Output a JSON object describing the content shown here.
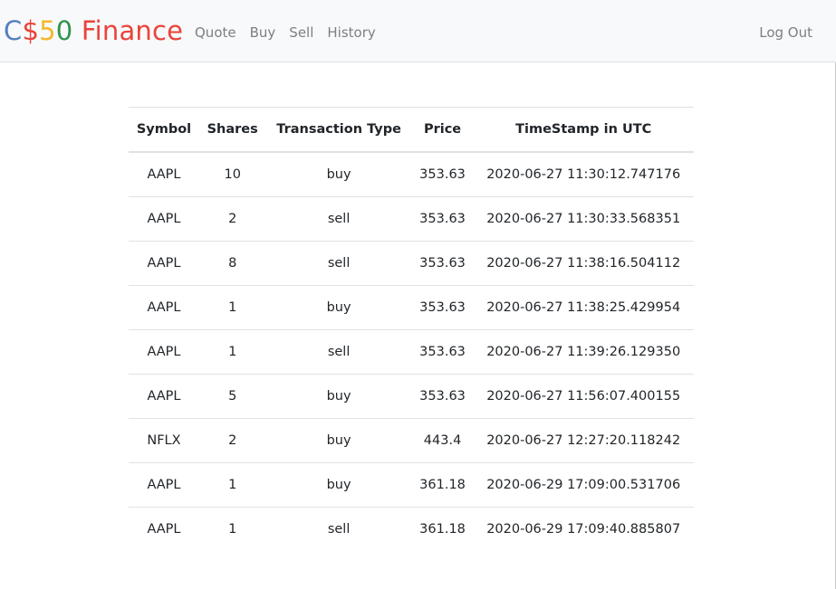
{
  "brand": {
    "c": "C",
    "dollar": "$",
    "five": "5",
    "zero": "0",
    "finance": " Finance"
  },
  "nav": {
    "quote": "Quote",
    "buy": "Buy",
    "sell": "Sell",
    "history": "History",
    "logout": "Log Out"
  },
  "colors": {
    "blue": "#537fbe",
    "red": "#ea433b",
    "yellow": "#f5b82e",
    "green": "#2e944b",
    "nav_bg": "#f8f9fa"
  },
  "table": {
    "headers": [
      "Symbol",
      "Shares",
      "Transaction Type",
      "Price",
      "TimeStamp in UTC"
    ],
    "rows": [
      [
        "AAPL",
        "10",
        "buy",
        "353.63",
        "2020-06-27 11:30:12.747176"
      ],
      [
        "AAPL",
        "2",
        "sell",
        "353.63",
        "2020-06-27 11:30:33.568351"
      ],
      [
        "AAPL",
        "8",
        "sell",
        "353.63",
        "2020-06-27 11:38:16.504112"
      ],
      [
        "AAPL",
        "1",
        "buy",
        "353.63",
        "2020-06-27 11:38:25.429954"
      ],
      [
        "AAPL",
        "1",
        "sell",
        "353.63",
        "2020-06-27 11:39:26.129350"
      ],
      [
        "AAPL",
        "5",
        "buy",
        "353.63",
        "2020-06-27 11:56:07.400155"
      ],
      [
        "NFLX",
        "2",
        "buy",
        "443.4",
        "2020-06-27 12:27:20.118242"
      ],
      [
        "AAPL",
        "1",
        "buy",
        "361.18",
        "2020-06-29 17:09:00.531706"
      ],
      [
        "AAPL",
        "1",
        "sell",
        "361.18",
        "2020-06-29 17:09:40.885807"
      ]
    ]
  }
}
